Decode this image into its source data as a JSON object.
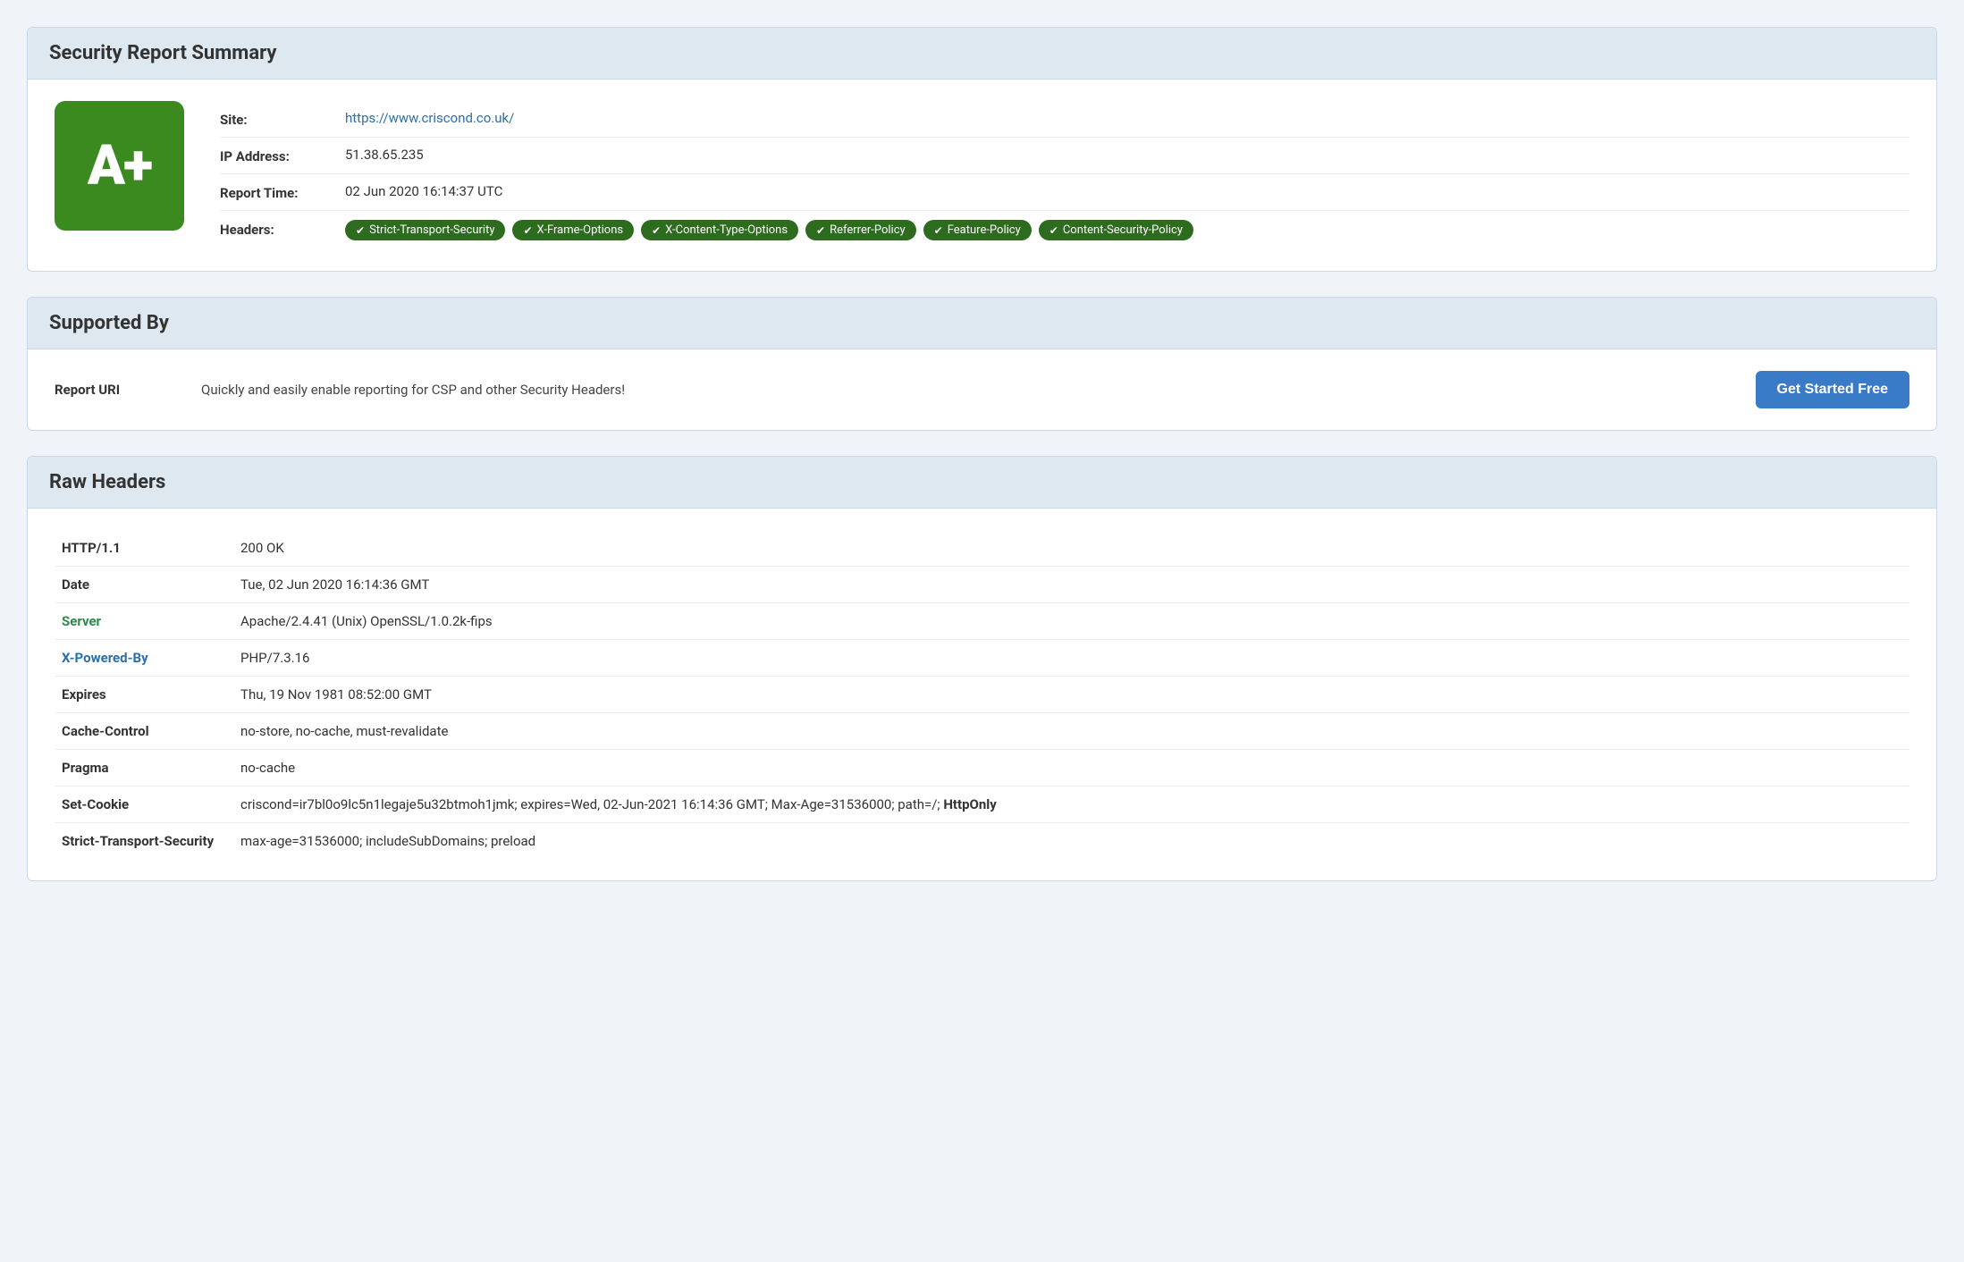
{
  "summary": {
    "title": "Security Report Summary",
    "grade": "A+",
    "site_label": "Site:",
    "site_url": "https://www.criscond.co.uk/",
    "ip_label": "IP Address:",
    "ip_value": "51.38.65.235",
    "report_time_label": "Report Time:",
    "report_time_value": "02 Jun 2020 16:14:37 UTC",
    "headers_label": "Headers:",
    "headers": [
      "Strict-Transport-Security",
      "X-Frame-Options",
      "X-Content-Type-Options",
      "Referrer-Policy",
      "Feature-Policy",
      "Content-Security-Policy"
    ]
  },
  "supported": {
    "title": "Supported By",
    "label": "Report URI",
    "description": "Quickly and easily enable reporting for CSP and other Security Headers!",
    "button_label": "Get Started Free"
  },
  "raw_headers": {
    "title": "Raw Headers",
    "rows": [
      {
        "label": "HTTP/1.1",
        "value": "200 OK",
        "label_type": "normal",
        "value_bold": ""
      },
      {
        "label": "Date",
        "value": "Tue, 02 Jun 2020 16:14:36 GMT",
        "label_type": "normal",
        "value_bold": ""
      },
      {
        "label": "Server",
        "value": "Apache/2.4.41 (Unix) OpenSSL/1.0.2k-fips",
        "label_type": "green",
        "value_bold": ""
      },
      {
        "label": "X-Powered-By",
        "value": "PHP/7.3.16",
        "label_type": "blue",
        "value_bold": ""
      },
      {
        "label": "Expires",
        "value": "Thu, 19 Nov 1981 08:52:00 GMT",
        "label_type": "normal",
        "value_bold": ""
      },
      {
        "label": "Cache-Control",
        "value": "no-store, no-cache, must-revalidate",
        "label_type": "normal",
        "value_bold": ""
      },
      {
        "label": "Pragma",
        "value": "no-cache",
        "label_type": "normal",
        "value_bold": ""
      },
      {
        "label": "Set-Cookie",
        "value": "criscond=ir7bl0o9lc5n1legaje5u32btmoh1jmk; expires=Wed, 02-Jun-2021 16:14:36 GMT; Max-Age=31536000; path=/; ",
        "label_type": "normal",
        "value_bold": "HttpOnly"
      },
      {
        "label": "Strict-Transport-Security",
        "value": "max-age=31536000; includeSubDomains; preload",
        "label_type": "normal",
        "value_bold": ""
      }
    ]
  }
}
